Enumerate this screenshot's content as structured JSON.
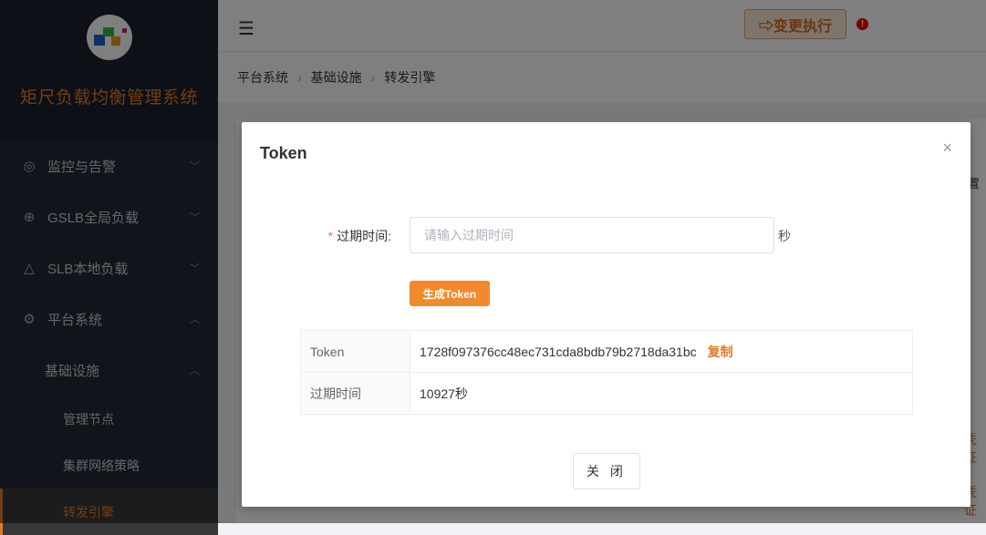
{
  "sidebar": {
    "brand": "矩尺负载均衡管理系统",
    "items": [
      {
        "label": "监控与告警",
        "icon": "camera-icon"
      },
      {
        "label": "GSLB全局负载",
        "icon": "globe-icon"
      },
      {
        "label": "SLB本地负载",
        "icon": "network-icon"
      },
      {
        "label": "平台系统",
        "icon": "gear-icon"
      }
    ],
    "sub": {
      "label": "基础设施"
    },
    "subsub": [
      {
        "label": "管理节点"
      },
      {
        "label": "集群网络策略"
      },
      {
        "label": "转发引擎"
      }
    ]
  },
  "header": {
    "exec_label": "⇨变更执行",
    "alert": "!"
  },
  "breadcrumb": [
    "平台系统",
    "基础设施",
    "转发引擎"
  ],
  "background_fragments": {
    "a": "置",
    "b": "凭证",
    "c": "凭证"
  },
  "modal": {
    "title": "Token",
    "close": "×",
    "expire_label": "过期时间:",
    "required": "*",
    "expire_placeholder": "请输入过期时间",
    "expire_value": "",
    "unit": "秒",
    "generate": "生成Token",
    "table": {
      "token_key": "Token",
      "token_value": "1728f097376cc48ec731cda8bdb79b2718da31bc",
      "copy": "复制",
      "exp_key": "过期时间",
      "exp_value": "10927秒"
    },
    "close_button": "关 闭"
  },
  "colors": {
    "accent": "#e07b2a",
    "sidebar": "#222a36"
  }
}
